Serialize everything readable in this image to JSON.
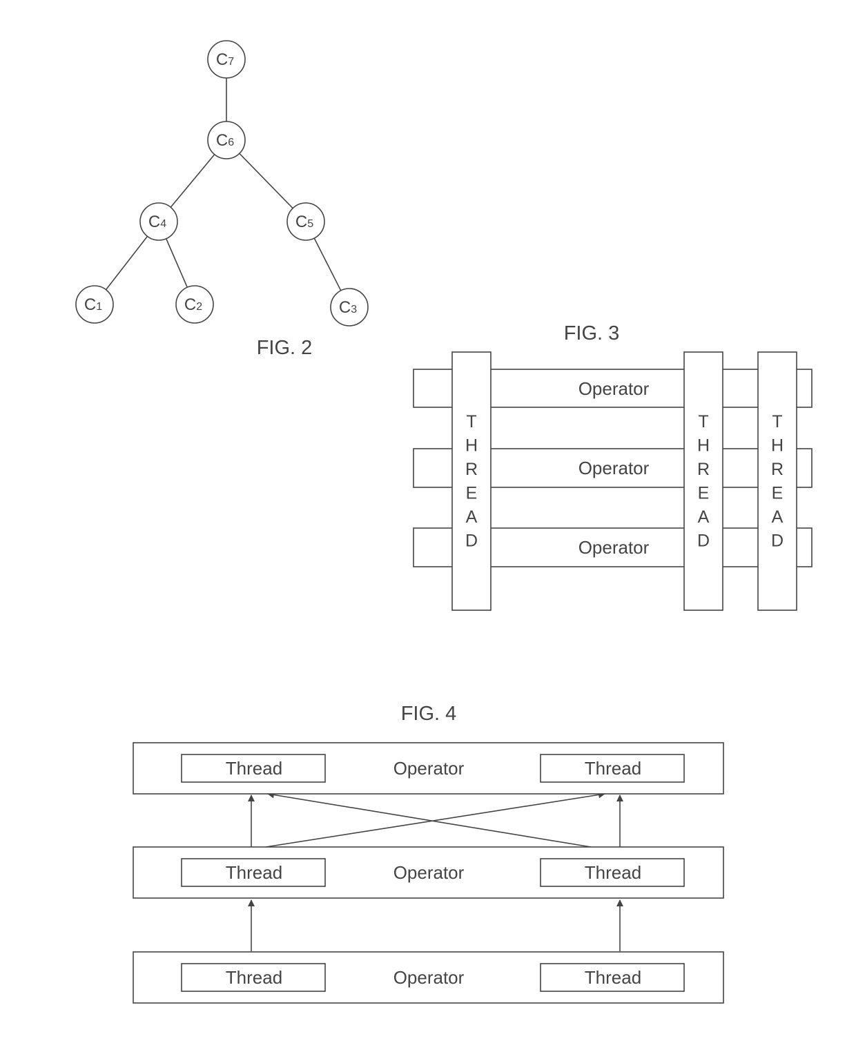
{
  "fig2": {
    "caption": "FIG. 2",
    "nodes": [
      {
        "id": "C7",
        "letter": "C",
        "index": "7"
      },
      {
        "id": "C6",
        "letter": "C",
        "index": "6"
      },
      {
        "id": "C4",
        "letter": "C",
        "index": "4"
      },
      {
        "id": "C5",
        "letter": "C",
        "index": "5"
      },
      {
        "id": "C1",
        "letter": "C",
        "index": "1"
      },
      {
        "id": "C2",
        "letter": "C",
        "index": "2"
      },
      {
        "id": "C3",
        "letter": "C",
        "index": "3"
      }
    ],
    "edges": [
      [
        "C7",
        "C6"
      ],
      [
        "C6",
        "C4"
      ],
      [
        "C6",
        "C5"
      ],
      [
        "C4",
        "C1"
      ],
      [
        "C4",
        "C2"
      ],
      [
        "C5",
        "C3"
      ]
    ]
  },
  "fig3": {
    "caption": "FIG. 3",
    "operators": [
      "Operator",
      "Operator",
      "Operator"
    ],
    "threads": [
      "THREAD",
      "THREAD",
      "THREAD"
    ]
  },
  "fig4": {
    "caption": "FIG. 4",
    "layers": [
      {
        "operator": "Operator",
        "threads": [
          "Thread",
          "Thread"
        ]
      },
      {
        "operator": "Operator",
        "threads": [
          "Thread",
          "Thread"
        ]
      },
      {
        "operator": "Operator",
        "threads": [
          "Thread",
          "Thread"
        ]
      }
    ]
  }
}
